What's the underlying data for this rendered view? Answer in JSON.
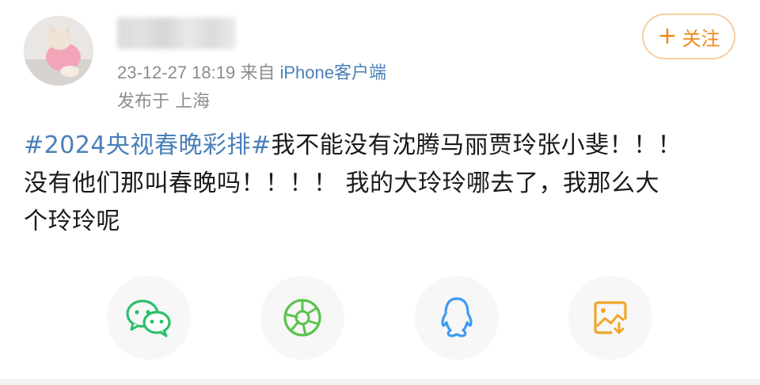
{
  "post": {
    "timestamp": "23-12-27 18:19",
    "source_prefix": "来自",
    "source": "iPhone客户端",
    "location": "发布于 上海",
    "hashtag": "#2024央视春晚彩排#",
    "text_line1_rest": "我不能没有沈腾马丽贾玲张小斐！！！",
    "text_line2": "没有他们那叫春晚吗！！！！ 我的大玲玲哪去了，我那么大",
    "text_line3": "个玲玲呢"
  },
  "follow_button": {
    "label": "关注",
    "plus": "+"
  },
  "share_bar": [
    {
      "icon": "wechat-icon"
    },
    {
      "icon": "moments-icon"
    },
    {
      "icon": "qq-icon"
    },
    {
      "icon": "save-image-icon"
    }
  ],
  "colors": {
    "accent": "#ee8a1e",
    "link": "#4a7fb8",
    "meta": "#8c8c8c",
    "wechat": "#2bbf6a"
  }
}
